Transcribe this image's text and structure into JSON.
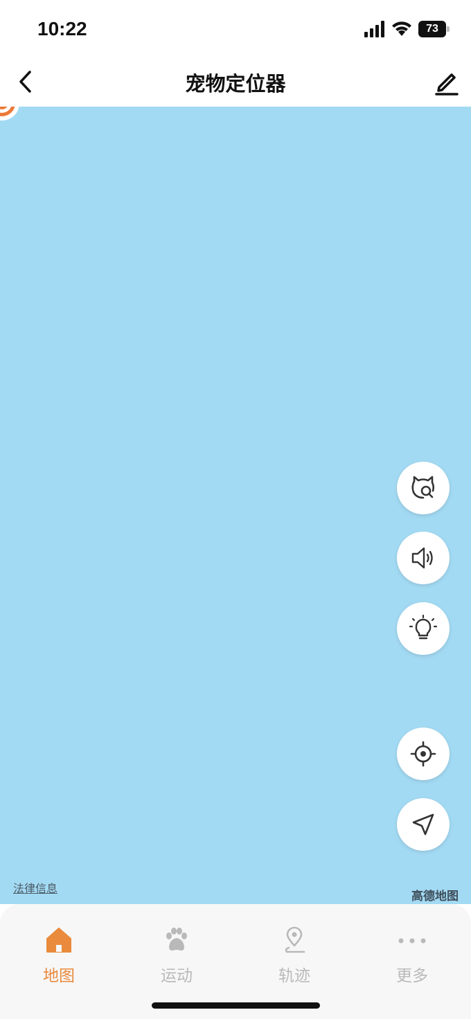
{
  "status_bar": {
    "time": "10:22",
    "battery": "73"
  },
  "nav": {
    "title": "宠物定位器",
    "back_icon": "chevron-left-icon",
    "edit_icon": "pencil-icon"
  },
  "map": {
    "legal_link": "法律信息",
    "provider_logo": "高德地图",
    "background_color": "#a3daf3",
    "actions": [
      {
        "name": "find-pet-button",
        "icon": "cat-search-icon"
      },
      {
        "name": "sound-button",
        "icon": "speaker-icon"
      },
      {
        "name": "light-button",
        "icon": "bulb-icon"
      },
      {
        "name": "locate-pet-button",
        "icon": "crosshair-icon"
      },
      {
        "name": "my-location-button",
        "icon": "navigation-arrow-icon"
      }
    ]
  },
  "tabs": [
    {
      "label": "地图",
      "icon": "home-icon",
      "active": true
    },
    {
      "label": "运动",
      "icon": "paw-icon",
      "active": false
    },
    {
      "label": "轨迹",
      "icon": "route-pin-icon",
      "active": false
    },
    {
      "label": "更多",
      "icon": "more-dots-icon",
      "active": false
    }
  ],
  "colors": {
    "accent": "#e98a3c",
    "inactive": "#b9b9b9"
  }
}
